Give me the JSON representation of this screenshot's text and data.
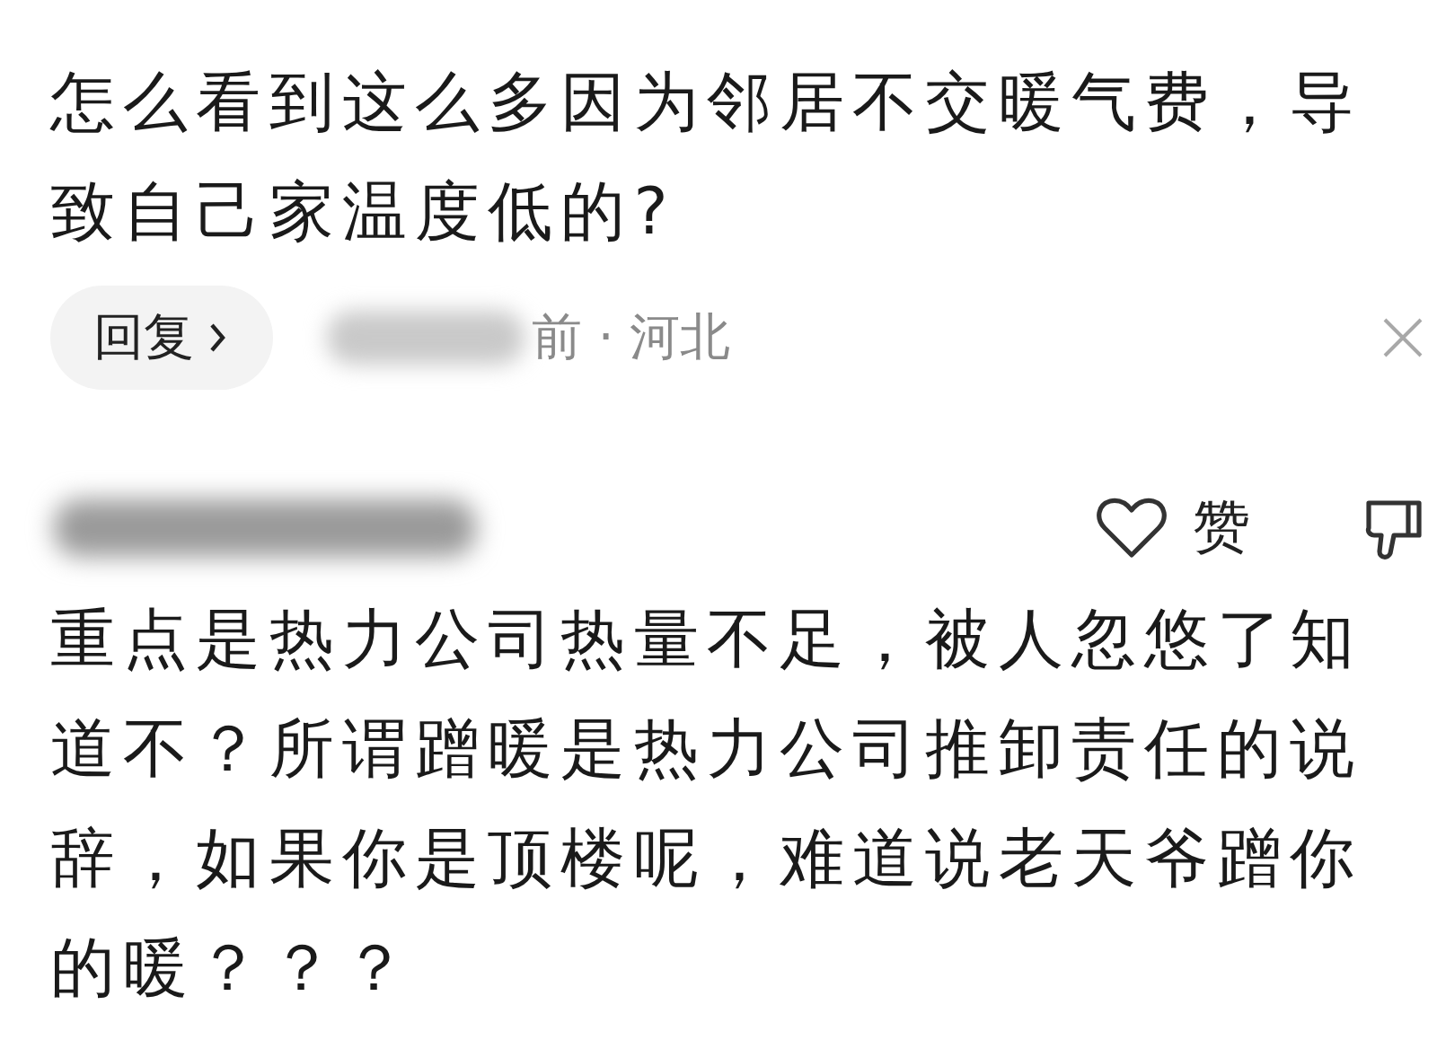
{
  "first_comment": {
    "text": "怎么看到这么多因为邻居不交暖气费，导致自己家温度低的?",
    "reply_button": "回复",
    "meta": "前 · 河北"
  },
  "second_comment": {
    "like_label": "赞",
    "text": "重点是热力公司热量不足，被人忽悠了知道不？所谓蹭暖是热力公司推卸责任的说辞，如果你是顶楼呢，难道说老天爷蹭你的暖？？？"
  }
}
